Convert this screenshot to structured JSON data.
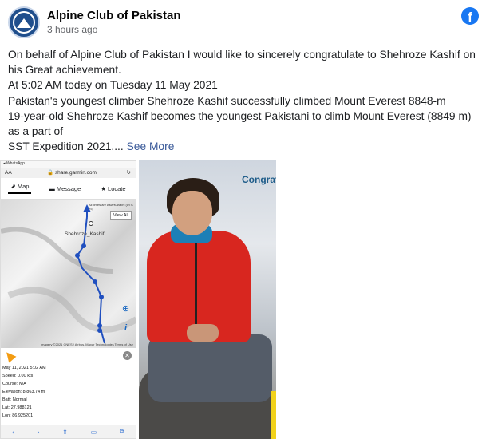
{
  "post": {
    "page_name": "Alpine Club of Pakistan",
    "time": "3 hours ago",
    "platform_icon": "facebook-icon",
    "lines": [
      "On behalf of Alpine Club of Pakistan I would like to sincerely congratulate to Shehroze Kashif on",
      "his Great achievement.",
      "At 5:02 AM today on Tuesday 11 May 2021",
      "Pakistan's youngest climber Shehroze Kashif successfully climbed Mount Everest 8848-m",
      "19-year-old Shehroze Kashif becomes the youngest Pakistani to climb Mount Everest (8849 m)",
      "as a part of",
      "SST Expedition 2021...."
    ],
    "see_more": "See More"
  },
  "phone": {
    "status": "◂ WhatsApp",
    "aa": "AA",
    "url": "🔒 share.garmin.com",
    "reload": "↻",
    "tabs": [
      {
        "icon": "map-icon",
        "glyph": "⬈",
        "label": "Map"
      },
      {
        "icon": "message-icon",
        "glyph": "▬",
        "label": "Message"
      },
      {
        "icon": "locate-icon",
        "glyph": "★",
        "label": "Locate"
      }
    ],
    "tz": "All times are Asia/Karachi (UTC +5)",
    "view_all": "View All",
    "map_label": "Shehroze_Kashif",
    "credit": "Imagery ©2021 CNES / Airbus, Maxar Technologies",
    "terms": "Terms of Use",
    "map_controls": [
      "⊕",
      "i"
    ],
    "close": "✕",
    "info": [
      "May 11, 2021 5:02 AM",
      "Speed: 0.00 kts",
      "Course: N/A",
      "Elevation: 8,863.74 m",
      "Batt: Normal",
      "Lat: 27.988121",
      "Lon: 86.925201"
    ],
    "bottom_icons": [
      "‹",
      "›",
      "⇪",
      "▭",
      "⧉"
    ]
  },
  "photo": {
    "overlay_text": "Congrat"
  },
  "colors": {
    "link": "#385898",
    "facebook": "#1877f2",
    "track": "#1f4fbf"
  }
}
